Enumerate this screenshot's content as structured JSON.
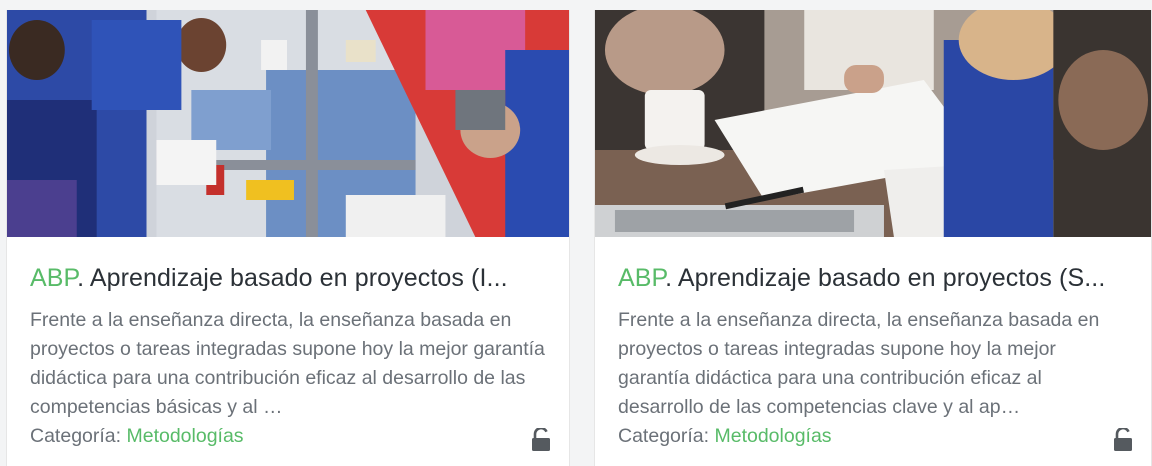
{
  "cards": [
    {
      "tag": "ABP",
      "title": ". Aprendizaje basado en proyectos (I...",
      "excerpt": "Frente a la enseñanza directa, la enseñanza basada en proyectos o tareas integradas supone hoy la mejor garantía didáctica para una contribución eficaz al desarrollo de las competencias básicas y al …",
      "category_label": "Categoría: ",
      "category": "Metodologías",
      "lock_icon": "unlocked-padlock-icon"
    },
    {
      "tag": "ABP",
      "title": ". Aprendizaje basado en proyectos (S...",
      "excerpt": "Frente a la enseñanza directa, la enseñanza basada en proyectos o tareas integradas supone hoy la mejor garantía didáctica para una contribución eficaz al desarrollo de las competencias clave y al ap…",
      "category_label": "Categoría: ",
      "category": "Metodologías",
      "lock_icon": "unlocked-padlock-icon"
    }
  ],
  "colors": {
    "accent": "#58bb68",
    "title": "#2b3137",
    "body_text": "#6b7178",
    "lock": "#555a5f"
  }
}
